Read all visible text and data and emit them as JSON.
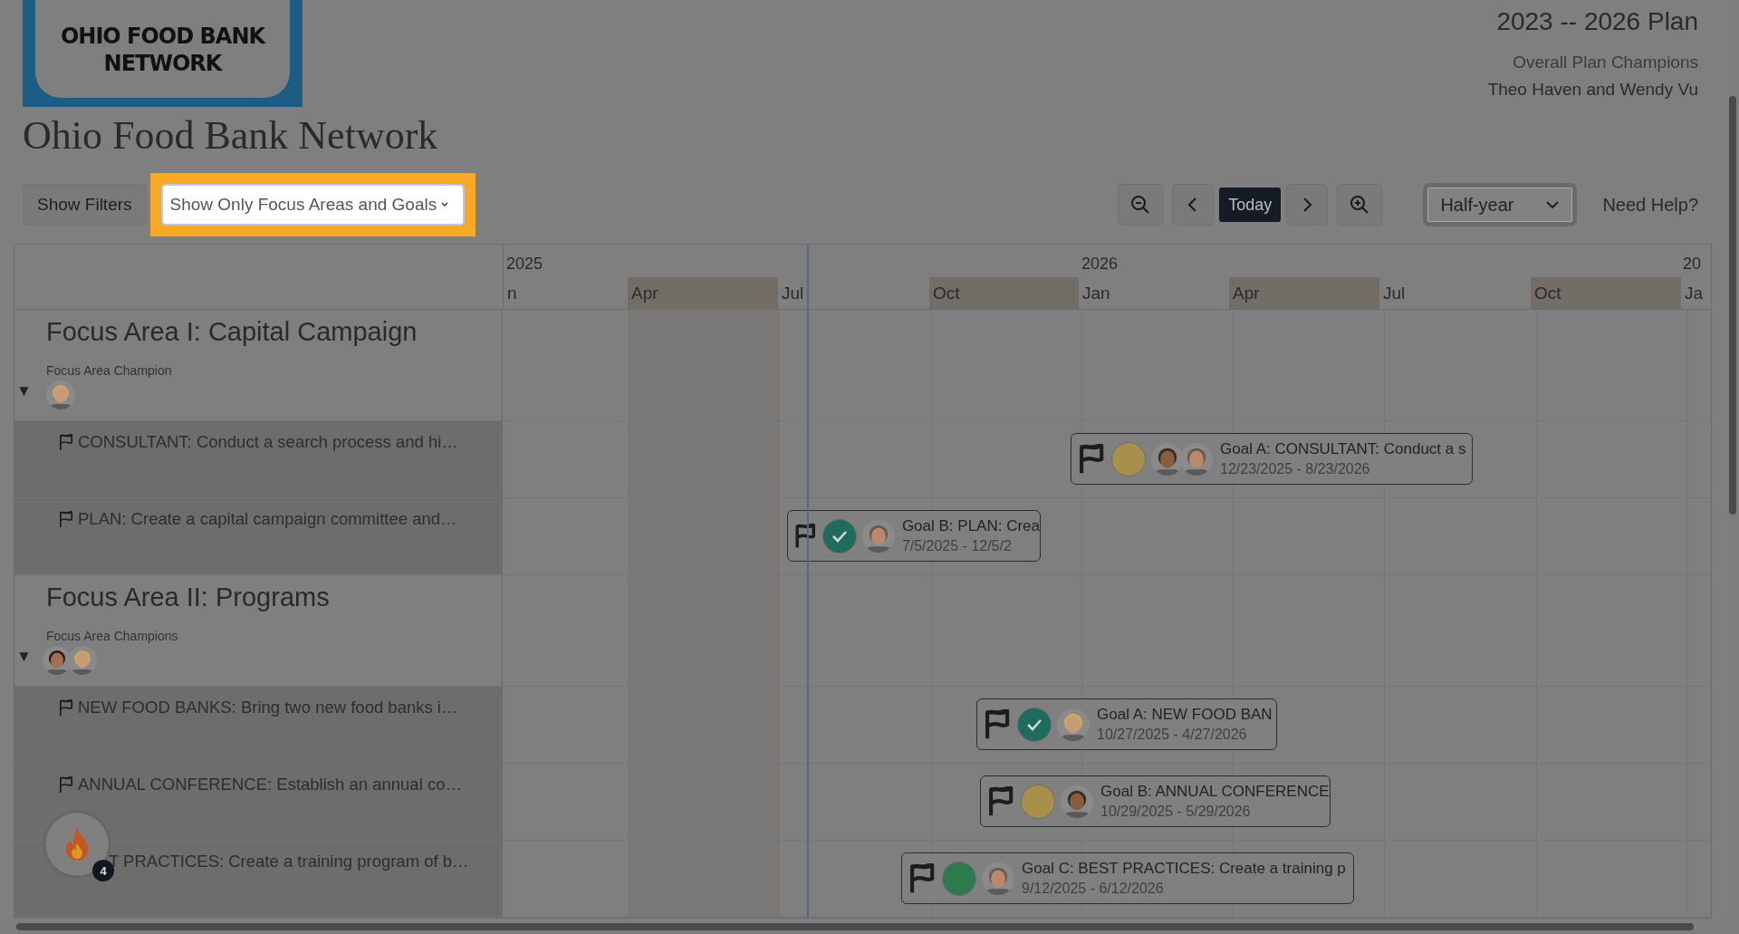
{
  "logo": {
    "text": "OHIO FOOD BANK NETWORK"
  },
  "org_title": "Ohio Food Bank Network",
  "plan": {
    "title": "2023 -- 2026 Plan",
    "champions_label": "Overall Plan Champions",
    "champions": "Theo Haven and Wendy Vu"
  },
  "toolbar": {
    "filters_button": "Show Filters",
    "view_select": {
      "value": "Show Only Focus Areas and Goals",
      "highlighted": true
    },
    "today_button": "Today",
    "scale_select": {
      "value": "Half-year"
    },
    "help_link": "Need Help?"
  },
  "timeline": {
    "years": [
      "2025",
      "2026",
      "20"
    ],
    "quarters": [
      {
        "label": "n",
        "shaded": false
      },
      {
        "label": "Apr",
        "shaded": true
      },
      {
        "label": "Jul",
        "shaded": false
      },
      {
        "label": "Oct",
        "shaded": true
      },
      {
        "label": "Jan",
        "shaded": false
      },
      {
        "label": "Apr",
        "shaded": true
      },
      {
        "label": "Jul",
        "shaded": false
      },
      {
        "label": "Oct",
        "shaded": true
      },
      {
        "label": "Ja",
        "shaded": false
      }
    ]
  },
  "rows": [
    {
      "kind": "focus_area",
      "title": "Focus Area I: Capital Campaign",
      "champion_label": "Focus Area Champion",
      "toggle": "▼",
      "expanded": true
    },
    {
      "kind": "goal",
      "flag": true,
      "label": "CONSULTANT: Conduct a search process and hi…",
      "bar": {
        "title": "Goal A: CONSULTANT: Conduct a s",
        "dates": "12/23/2025 - 8/23/2026",
        "color": "#a8904c",
        "checked": false
      }
    },
    {
      "kind": "goal",
      "flag": true,
      "label": "PLAN: Create a capital campaign committee and…",
      "bar": {
        "title": "Goal B: PLAN: Crea",
        "dates": "7/5/2025 - 12/5/2",
        "color": "#1f6b5d",
        "checked": true
      }
    },
    {
      "kind": "focus_area",
      "title": "Focus Area II: Programs",
      "champion_label": "Focus Area Champions",
      "toggle": "▼",
      "expanded": true
    },
    {
      "kind": "goal",
      "flag": true,
      "label": "NEW FOOD BANKS: Bring two new food banks i…",
      "bar": {
        "title": "Goal A: NEW FOOD BAN",
        "dates": "10/27/2025 - 4/27/2026",
        "color": "#1f6b5d",
        "checked": true
      }
    },
    {
      "kind": "goal",
      "flag": true,
      "label": "ANNUAL CONFERENCE: Establish an annual co…",
      "bar": {
        "title": "Goal B: ANNUAL CONFERENCE",
        "dates": "10/29/2025 - 5/29/2026",
        "color": "#a8904c",
        "checked": false
      }
    },
    {
      "kind": "goal",
      "flag": false,
      "label": "T PRACTICES: Create a training program of b…",
      "bar": {
        "title": "Goal C: BEST PRACTICES: Create a training p",
        "dates": "9/12/2025 - 6/12/2026",
        "color": "#2c7a4d",
        "checked": false
      }
    }
  ],
  "notification_widget": {
    "count": "4"
  }
}
